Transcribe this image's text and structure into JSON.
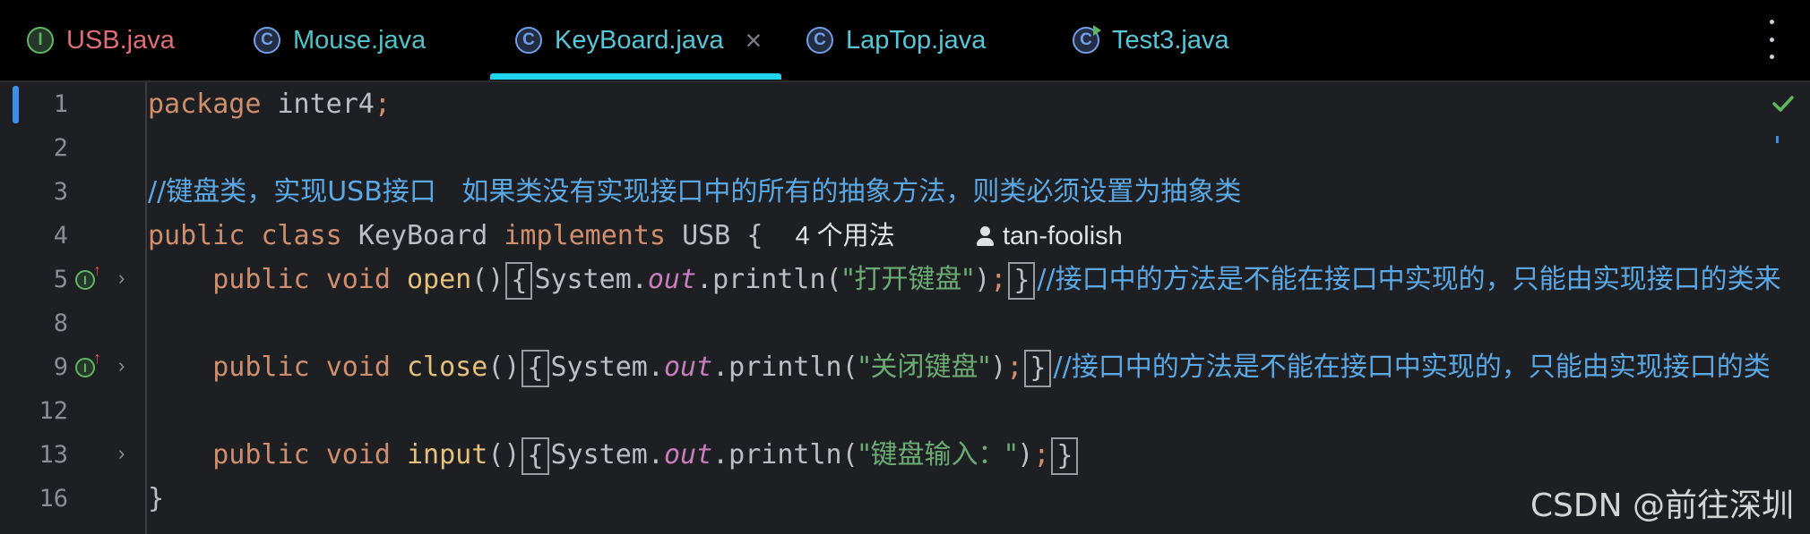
{
  "tabs": [
    {
      "label": "USB.java",
      "icon": "interface-icon",
      "color": "#e06c75"
    },
    {
      "label": "Mouse.java",
      "icon": "class-icon",
      "color": "#4fc3c7"
    },
    {
      "label": "KeyBoard.java",
      "icon": "class-icon",
      "color": "#56c7d8",
      "active": true
    },
    {
      "label": "LapTop.java",
      "icon": "class-icon",
      "color": "#56c7d8"
    },
    {
      "label": "Test3.java",
      "icon": "runnable-class-icon",
      "color": "#56c7d8"
    }
  ],
  "tab_icon_glyphs": {
    "interface": "I",
    "class": "C"
  },
  "close_glyph": "×",
  "line_numbers": [
    "1",
    "2",
    "3",
    "4",
    "5",
    "8",
    "9",
    "12",
    "13",
    "16"
  ],
  "code": {
    "l1_kw": "package",
    "l1_rest": " inter4",
    "l1_semi": ";",
    "l3_comment": "//键盘类，实现USB接口   如果类没有实现接口中的所有的抽象方法，则类必须设置为抽象类",
    "l4_kw1": "public",
    "l4_kw2": "class",
    "l4_name": "KeyBoard",
    "l4_kw3": "implements",
    "l4_iface": "USB",
    "l4_brace": "{",
    "usages_hint": "4 个用法",
    "author_hint": "tan-foolish",
    "m_public": "public",
    "m_void": "void",
    "open_name": "open",
    "close_name": "close",
    "input_name": "input",
    "parens": "()",
    "lbrace": "{",
    "rbrace": "}",
    "sys": "System.",
    "out": "out",
    "println": ".println(",
    "open_str": "\"打开键盘\"",
    "close_str": "\"关闭键盘\"",
    "input_str": "\"键盘输入：\"",
    "rparen": ")",
    "semi": ";",
    "method_comment_open": "//接口中的方法是不能在接口中实现的，只能由实现接口的类来",
    "method_comment_close": "//接口中的方法是不能在接口中实现的，只能由实现接口的类",
    "class_close": "}"
  },
  "gutter": {
    "impl_glyph": "I",
    "arrow_glyph": "↑",
    "fold_glyph": "›"
  },
  "status": {
    "inspection": "check-icon"
  },
  "watermark": "CSDN @前往深圳",
  "colors": {
    "keyword": "#cf8e6d",
    "method": "#e5c07b",
    "string": "#6aab73",
    "comment": "#5aa9e6",
    "field": "#c77dbb",
    "accent": "#22d3ee"
  }
}
